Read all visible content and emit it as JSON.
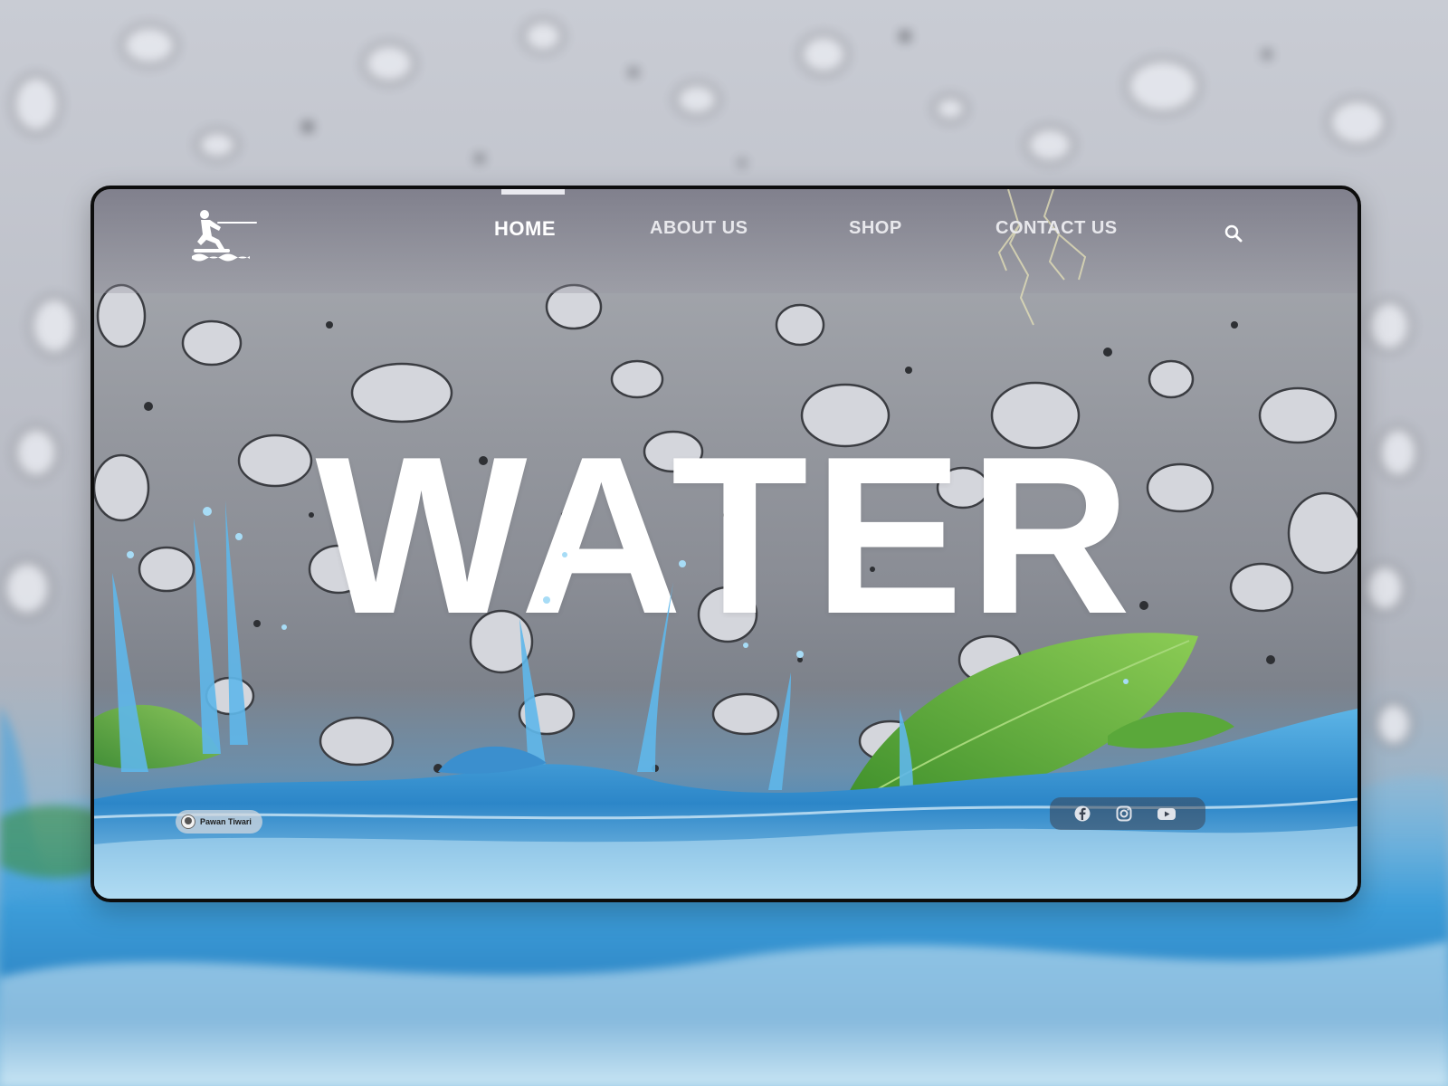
{
  "brand": {
    "logo": "water-skier-icon"
  },
  "nav": {
    "items": [
      {
        "label": "HOME",
        "active": true
      },
      {
        "label": "ABOUT US",
        "active": false
      },
      {
        "label": "SHOP",
        "active": false
      },
      {
        "label": "CONTACT US",
        "active": false
      }
    ],
    "search_icon": "search-icon"
  },
  "hero": {
    "title": "WATER"
  },
  "credit": {
    "name": "Pawan Tiwari",
    "avatar_icon": "user-avatar-icon"
  },
  "social": {
    "icons": [
      "facebook-icon",
      "instagram-icon",
      "youtube-icon"
    ]
  },
  "colors": {
    "text": "#ffffff",
    "nav_text": "#e8e8ec",
    "frame_border": "#0d0d0d",
    "water_blue": "#3e8dc6",
    "leaf_green": "#5aa83a"
  }
}
